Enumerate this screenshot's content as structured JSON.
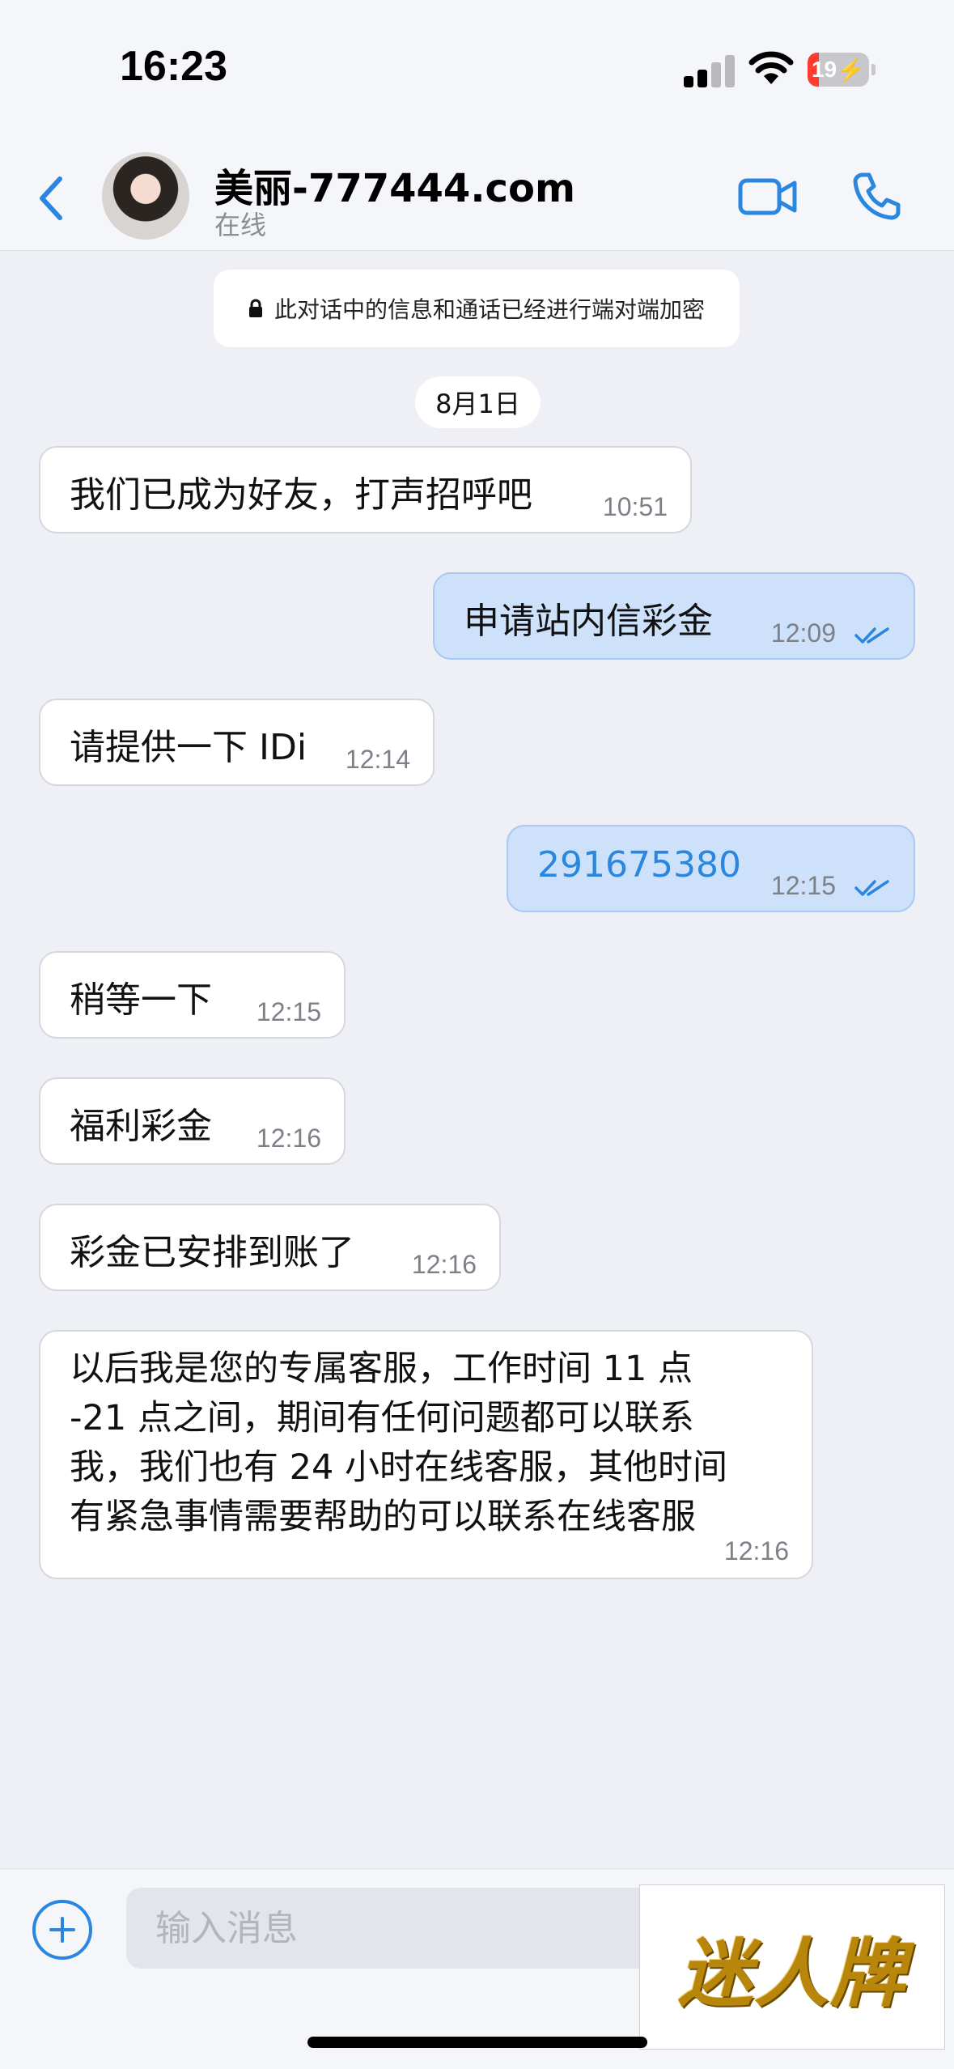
{
  "status_bar": {
    "time": "16:23",
    "battery": "19",
    "battery_level_percent": 19,
    "battery_color": "#ff3b30"
  },
  "header": {
    "contact_name": "美丽-777444.com",
    "contact_status": "在线",
    "accent_color": "#2b86e0",
    "icons": [
      "chevron-left-icon",
      "video-camera-icon",
      "phone-icon"
    ]
  },
  "chat": {
    "encryption_notice": "此对话中的信息和通话已经进行端对端加密",
    "date": "8月1日",
    "messages": [
      {
        "direction": "in",
        "text": "我们已成为好友，打声招呼吧",
        "time": "10:51"
      },
      {
        "direction": "out",
        "text": "申请站内信彩金",
        "time": "12:09",
        "read": true
      },
      {
        "direction": "in",
        "text": "请提供一下 IDi",
        "time": "12:14"
      },
      {
        "direction": "out",
        "text": "291675380",
        "time": "12:15",
        "read": true
      },
      {
        "direction": "in",
        "text": "稍等一下",
        "time": "12:15"
      },
      {
        "direction": "in",
        "text": "福利彩金",
        "time": "12:16"
      },
      {
        "direction": "in",
        "text": "彩金已安排到账了",
        "time": "12:16"
      },
      {
        "direction": "in",
        "lines": [
          "以后我是您的专属客服，工作时间 11 点",
          "-21 点之间，期间有任何问题都可以联系",
          "我，我们也有 24 小时在线客服，其他时间",
          "有紧急事情需要帮助的可以联系在线客服"
        ],
        "time": "12:16"
      }
    ]
  },
  "input_bar": {
    "placeholder": "输入消息"
  },
  "watermark": {
    "text": "迷人牌"
  }
}
